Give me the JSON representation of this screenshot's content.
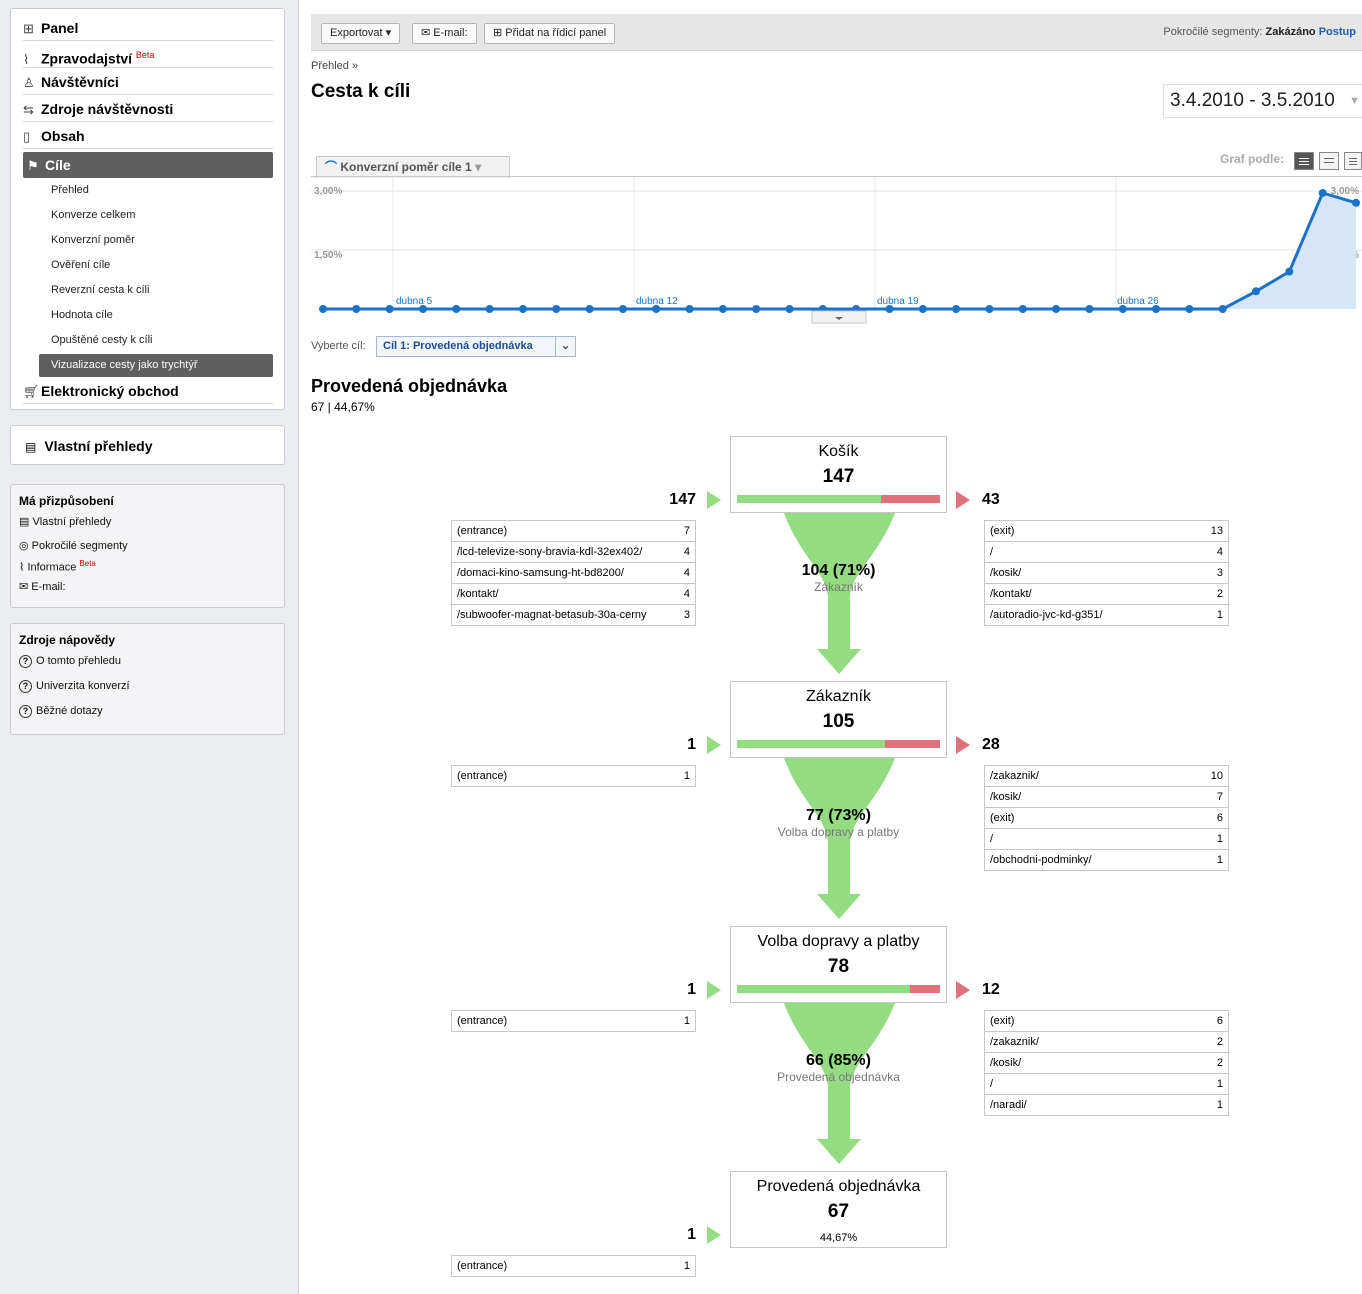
{
  "sidebar": {
    "nav": [
      {
        "label": "Panel",
        "icon": "grid-icon"
      },
      {
        "label": "Zpravodajství",
        "badge": "Beta",
        "icon": "chart-icon"
      },
      {
        "label": "Návštěvníci",
        "icon": "person-icon"
      },
      {
        "label": "Zdroje návštěvnosti",
        "icon": "arrows-icon"
      },
      {
        "label": "Obsah",
        "icon": "page-icon"
      },
      {
        "label": "Cíle",
        "icon": "flag-icon"
      }
    ],
    "goals_sub": [
      "Přehled",
      "Konverze celkem",
      "Konverzní poměr",
      "Ověření cíle",
      "Reverzní cesta k cíli",
      "Hodnota cíle",
      "Opuštěné cesty k cíli",
      "Vizualizace cesty jako trychtýř"
    ],
    "ecommerce": {
      "label": "Elektronický obchod",
      "icon": "cart-icon"
    },
    "custom_reports": "Vlastní přehledy",
    "customization": {
      "title": "Má přizpůsobení",
      "links": [
        {
          "label": "Vlastní přehledy"
        },
        {
          "label": "Pokročilé segmenty"
        },
        {
          "label": "Informace",
          "badge": "Beta"
        },
        {
          "label": "E-mail:"
        }
      ]
    },
    "help": {
      "title": "Zdroje nápovědy",
      "links": [
        "O tomto přehledu",
        "Univerzita konverzí",
        "Běžné dotazy"
      ]
    }
  },
  "toolbar": {
    "export": "Exportovat",
    "email": "E-mail:",
    "add_dashboard": "Přidat na řídicí panel",
    "segments_label": "Pokročilé segmenty:",
    "segments_value": "Zakázáno",
    "segments_link": "Postup"
  },
  "breadcrumb": "Přehled »",
  "page_title": "Cesta k cíli",
  "date_range": "3.4.2010 - 3.5.2010",
  "metric_tab": "Konverzní poměr cíle 1",
  "graph_by_label": "Graf podle:",
  "goal_select": {
    "label": "Vyberte cíl:",
    "value": "Cíl 1: Provedená objednávka"
  },
  "goal": {
    "title": "Provedená objednávka",
    "summary": "67 | 44,67%"
  },
  "chart_data": {
    "type": "area",
    "y_ticks": [
      "3,00%",
      "1,50%"
    ],
    "y_ticks_right": [
      "3,00%",
      "1,50%"
    ],
    "ylim": [
      0,
      3.0
    ],
    "x_labels": [
      "dubna 5",
      "dubna 12",
      "dubna 19",
      "dubna 26"
    ],
    "color": "#1a72c9",
    "fill": "#d4e6f7",
    "series": [
      {
        "values": [
          0,
          0,
          0,
          0,
          0,
          0,
          0,
          0,
          0,
          0,
          0,
          0,
          0,
          0,
          0,
          0,
          0,
          0,
          0,
          0,
          0,
          0,
          0,
          0,
          0,
          0,
          0,
          0,
          0.45,
          0.95,
          2.95,
          2.7
        ]
      }
    ]
  },
  "funnel": {
    "steps": [
      {
        "name": "Košík",
        "value": "147",
        "in": "147",
        "out": "43",
        "continue_pct": 0.71,
        "entrances": [
          [
            "(entrance)",
            "7"
          ],
          [
            "/lcd-televize-sony-bravia-kdl-32ex402/",
            "4"
          ],
          [
            "/domaci-kino-samsung-ht-bd8200/",
            "4"
          ],
          [
            "/kontakt/",
            "4"
          ],
          [
            "/subwoofer-magnat-betasub-30a-cerny",
            "3"
          ]
        ],
        "exits": [
          [
            "(exit)",
            "13"
          ],
          [
            "/",
            "4"
          ],
          [
            "/kosik/",
            "3"
          ],
          [
            "/kontakt/",
            "2"
          ],
          [
            "/autoradio-jvc-kd-g351/",
            "1"
          ]
        ],
        "conv_value": "104 (71%)",
        "conv_next": "Zákazník"
      },
      {
        "name": "Zákazník",
        "value": "105",
        "in": "1",
        "out": "28",
        "continue_pct": 0.73,
        "entrances": [
          [
            "(entrance)",
            "1"
          ]
        ],
        "exits": [
          [
            "/zakaznik/",
            "10"
          ],
          [
            "/kosik/",
            "7"
          ],
          [
            "(exit)",
            "6"
          ],
          [
            "/",
            "1"
          ],
          [
            "/obchodni-podminky/",
            "1"
          ]
        ],
        "conv_value": "77 (73%)",
        "conv_next": "Volba dopravy a platby"
      },
      {
        "name": "Volba dopravy a platby",
        "value": "78",
        "in": "1",
        "out": "12",
        "continue_pct": 0.85,
        "entrances": [
          [
            "(entrance)",
            "1"
          ]
        ],
        "exits": [
          [
            "(exit)",
            "6"
          ],
          [
            "/zakaznik/",
            "2"
          ],
          [
            "/kosik/",
            "2"
          ],
          [
            "/",
            "1"
          ],
          [
            "/naradi/",
            "1"
          ]
        ],
        "conv_value": "66 (85%)",
        "conv_next": "Provedená objednávka"
      },
      {
        "name": "Provedená objednávka",
        "value": "67",
        "in": "1",
        "pct": "44,67%",
        "entrances": [
          [
            "(entrance)",
            "1"
          ]
        ]
      }
    ]
  }
}
